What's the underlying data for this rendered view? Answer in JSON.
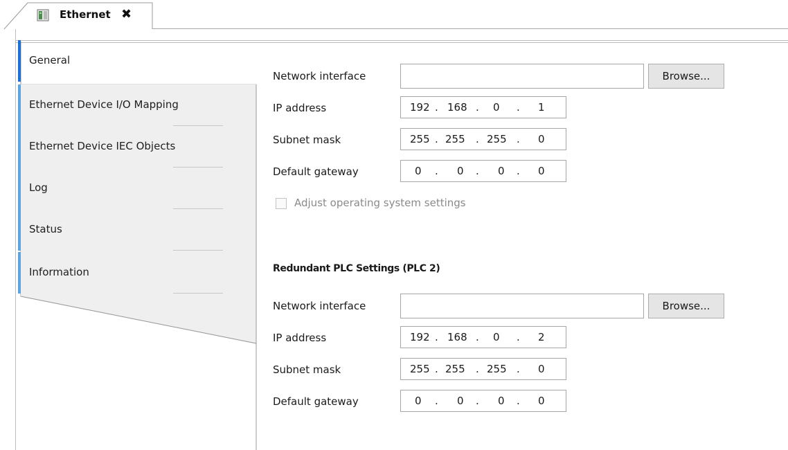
{
  "editor_tab": {
    "title": "Ethernet",
    "close_icon": "close-icon",
    "device_icon": "ethernet-device-icon"
  },
  "vertical_tabs": [
    {
      "label": "General",
      "active": true
    },
    {
      "label": "Ethernet Device I/O Mapping",
      "active": false
    },
    {
      "label": "Ethernet Device IEC Objects",
      "active": false
    },
    {
      "label": "Log",
      "active": false
    },
    {
      "label": "Status",
      "active": false
    },
    {
      "label": "Information",
      "active": false
    }
  ],
  "plc1": {
    "network_interface_label": "Network interface",
    "network_interface_value": "",
    "browse_label": "Browse...",
    "ip_label": "IP address",
    "ip": [
      "192",
      "168",
      "0",
      "1"
    ],
    "subnet_label": "Subnet mask",
    "subnet": [
      "255",
      "255",
      "255",
      "0"
    ],
    "gateway_label": "Default gateway",
    "gateway": [
      "0",
      "0",
      "0",
      "0"
    ],
    "adjust_os_label": "Adjust operating system settings",
    "adjust_os_checked": false
  },
  "plc2": {
    "section_title": "Redundant PLC Settings (PLC 2)",
    "network_interface_label": "Network interface",
    "network_interface_value": "",
    "browse_label": "Browse...",
    "ip_label": "IP address",
    "ip": [
      "192",
      "168",
      "0",
      "2"
    ],
    "subnet_label": "Subnet mask",
    "subnet": [
      "255",
      "255",
      "255",
      "0"
    ],
    "gateway_label": "Default gateway",
    "gateway": [
      "0",
      "0",
      "0",
      "0"
    ]
  },
  "colors": {
    "active_tab_accent": "#1e6fd0",
    "tab_accent": "#5da3e0",
    "button_bg": "#e5e5e5"
  }
}
